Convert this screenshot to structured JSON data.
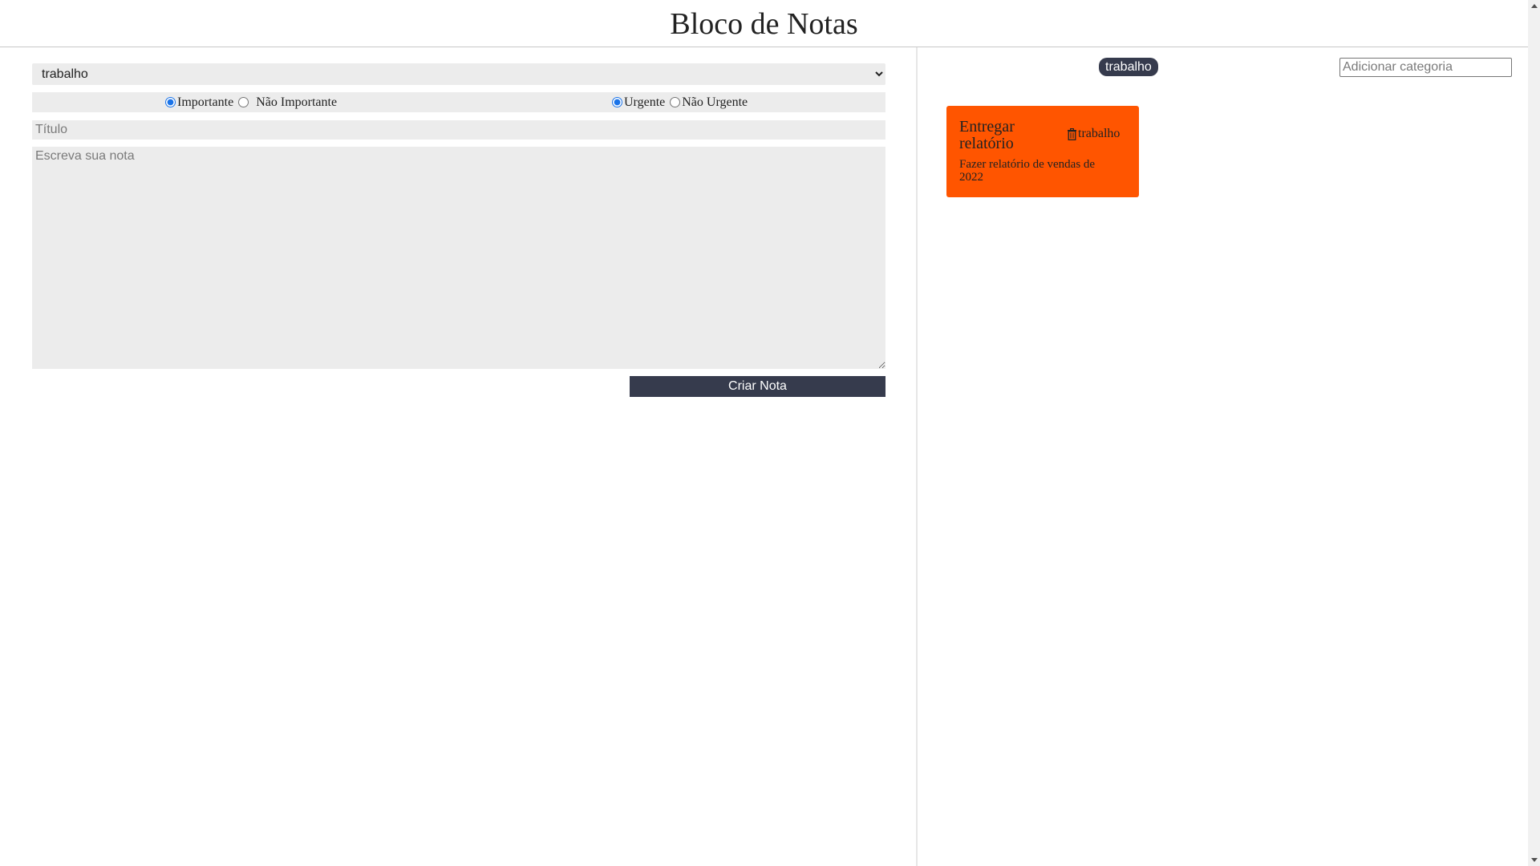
{
  "header": {
    "title": "Bloco de Notas"
  },
  "form": {
    "category_selected": "trabalho",
    "importance_options": [
      "Importante",
      "Não Importante"
    ],
    "urgency_options": [
      "Urgente",
      "Não Urgente"
    ],
    "title_placeholder": "Título",
    "body_placeholder": "Escreva sua nota",
    "submit_label": "Criar Nota"
  },
  "sidebar": {
    "categories": [
      "trabalho"
    ],
    "add_category_placeholder": "Adicionar categoria"
  },
  "notes": [
    {
      "title": "Entregar relatório",
      "category": "trabalho",
      "text": "Fazer relatório de vendas de 2022",
      "color": "#ff5500",
      "icon": "trash-icon"
    }
  ],
  "colors": {
    "accent": "#363b4d",
    "note": "#ff5500",
    "field": "#ececec"
  }
}
